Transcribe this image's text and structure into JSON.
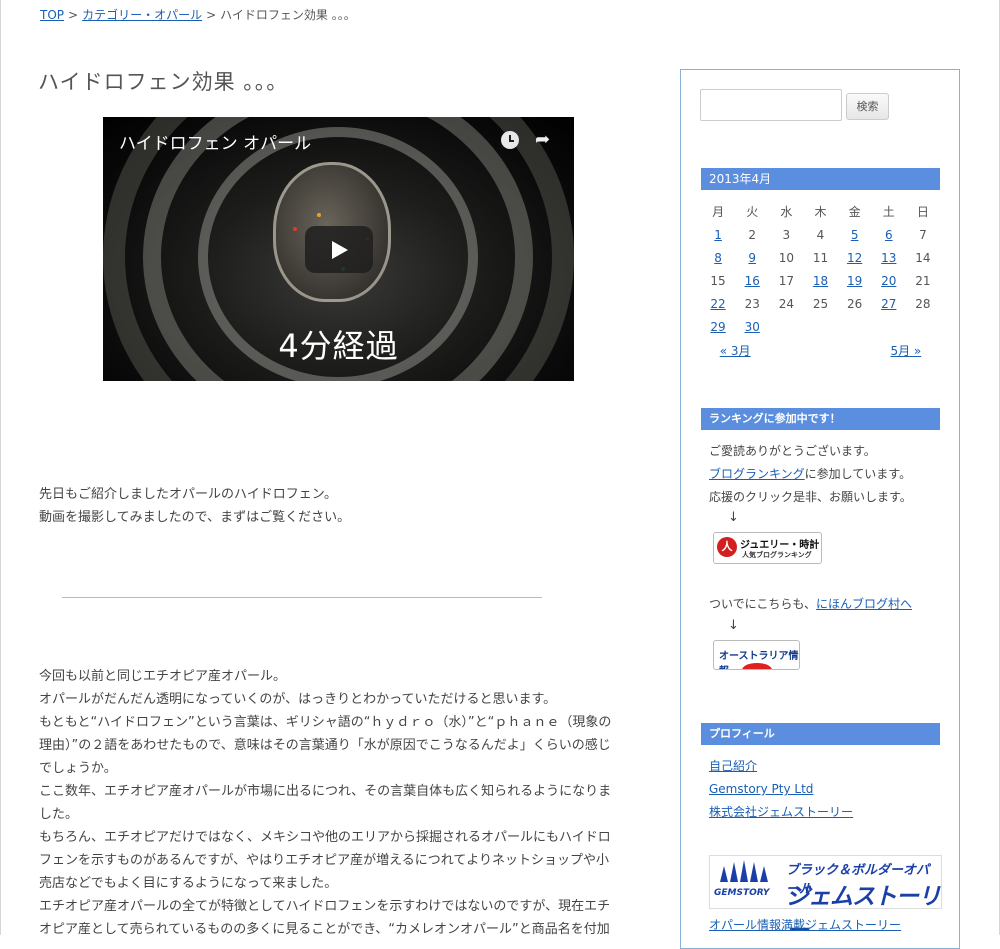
{
  "breadcrumb": {
    "top": "TOP",
    "sep": ">",
    "category": "カテゴリー・オパール",
    "current": "ハイドロフェン効果 。。。"
  },
  "post": {
    "title": "ハイドロフェン効果 。。。",
    "video": {
      "title": "ハイドロフェン オパール",
      "caption": "4分経過"
    },
    "intro": [
      "先日もご紹介しましたオパールのハイドロフェン。",
      "動画を撮影してみましたので、まずはご覧ください。"
    ],
    "body": [
      "今回も以前と同じエチオピア産オパール。",
      "オパールがだんだん透明になっていくのが、はっきりとわかっていただけると思います。",
      "もともと“ハイドロフェン”という言葉は、ギリシャ語の“ｈｙｄｒｏ（水）”と“ｐｈａｎｅ（現象の",
      "理由）”の２語をあわせたもので、意味はその言葉通り「水が原因でこうなるんだよ」くらいの感じ",
      "でしょうか。",
      "ここ数年、エチオピア産オパールが市場に出るにつれ、その言葉自体も広く知られるようになりま",
      "した。",
      "もちろん、エチオピアだけではなく、メキシコや他のエリアから採掘されるオパールにもハイドロ",
      "フェンを示すものがあるんですが、やはりエチオピア産が増えるにつれてよりネットショップや小",
      "売店などでもよく目にするようになって来ました。",
      "エチオピア産オパールの全てが特徴としてハイドロフェンを示すわけではないのですが、現在エチ",
      "オピア産として売られているものの多くに見ることができ、“カメレオンオパール”と商品名を付加"
    ]
  },
  "sidebar": {
    "search": {
      "placeholder": "",
      "button": "検索"
    },
    "calendar": {
      "caption": "2013年4月",
      "weekdays": [
        "月",
        "火",
        "水",
        "木",
        "金",
        "土",
        "日"
      ],
      "weeks": [
        [
          "1",
          "2",
          "3",
          "4",
          "5",
          "6",
          "7"
        ],
        [
          "8",
          "9",
          "10",
          "11",
          "12",
          "13",
          "14"
        ],
        [
          "15",
          "16",
          "17",
          "18",
          "19",
          "20",
          "21"
        ],
        [
          "22",
          "23",
          "24",
          "25",
          "26",
          "27",
          "28"
        ],
        [
          "29",
          "30",
          "",
          "",
          "",
          "",
          ""
        ]
      ],
      "linked_days": [
        "1",
        "5",
        "6",
        "8",
        "9",
        "12",
        "13",
        "16",
        "18",
        "19",
        "20",
        "22",
        "27",
        "29",
        "30"
      ],
      "prev": "« 3月",
      "next": "5月 »"
    },
    "ranking": {
      "heading": "ランキングに参加中です！",
      "line1": "ご愛読ありがとうございます。",
      "link": "ブログランキング",
      "line2_suffix": "に参加しています。",
      "line3": "応援のクリック是非、お願いします。",
      "arrow": "↓",
      "banner1_line1": "ジュエリー・時計",
      "banner1_line2": "人気ブログランキング",
      "line4": "ついでにこちらも、",
      "link2": "にほんブログ村へ",
      "banner2": "オーストラリア情報"
    },
    "profile": {
      "heading": "プロフィール",
      "links": [
        "自己紹介",
        "Gemstory Pty Ltd",
        "株式会社ジェムストーリー"
      ],
      "banner_sub": "ブラック＆ボルダーオパール",
      "banner_main": "ジェムストーリー",
      "banner_logo": "GEMSTORY",
      "bottom_link": "オパール情報満載ジェムストーリー"
    }
  },
  "colors": {
    "link": "#1a5fb4",
    "widget_head": "#5b8ede",
    "sidebar_border": "#8ab0d6"
  }
}
